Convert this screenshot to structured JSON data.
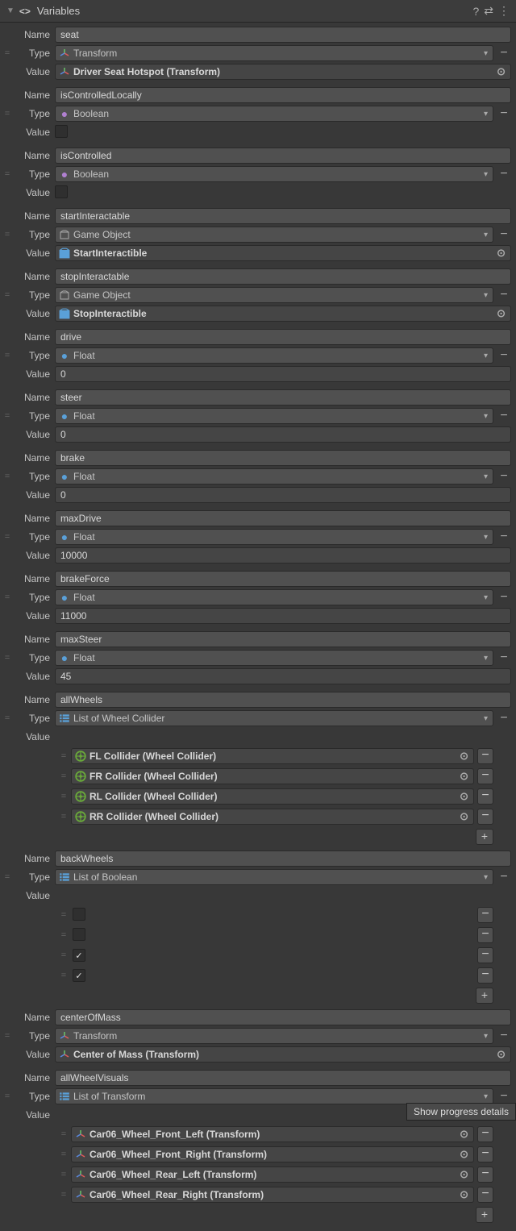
{
  "header": {
    "title": "Variables"
  },
  "labels": {
    "name": "Name",
    "type": "Type",
    "value": "Value"
  },
  "vars": [
    {
      "name": "seat",
      "type": "Transform",
      "typeIcon": "transform",
      "value": "Driver Seat Hotspot (Transform)",
      "valueKind": "obj"
    },
    {
      "name": "isControlledLocally",
      "type": "Boolean",
      "typeIcon": "bool",
      "valueKind": "checkbox",
      "checked": false
    },
    {
      "name": "isControlled",
      "type": "Boolean",
      "typeIcon": "bool",
      "valueKind": "checkbox",
      "checked": false
    },
    {
      "name": "startInteractable",
      "type": "Game Object",
      "typeIcon": "go",
      "value": "StartInteractible",
      "valueKind": "obj-prefab"
    },
    {
      "name": "stopInteractable",
      "type": "Game Object",
      "typeIcon": "go",
      "value": "StopInteractible",
      "valueKind": "obj-prefab"
    },
    {
      "name": "drive",
      "type": "Float",
      "typeIcon": "float",
      "value": "0",
      "valueKind": "text"
    },
    {
      "name": "steer",
      "type": "Float",
      "typeIcon": "float",
      "value": "0",
      "valueKind": "text"
    },
    {
      "name": "brake",
      "type": "Float",
      "typeIcon": "float",
      "value": "0",
      "valueKind": "text"
    },
    {
      "name": "maxDrive",
      "type": "Float",
      "typeIcon": "float",
      "value": "10000",
      "valueKind": "text"
    },
    {
      "name": "brakeForce",
      "type": "Float",
      "typeIcon": "float",
      "value": "11000",
      "valueKind": "text"
    },
    {
      "name": "maxSteer",
      "type": "Float",
      "typeIcon": "float",
      "value": "45",
      "valueKind": "text"
    },
    {
      "name": "allWheels",
      "type": "List of Wheel Collider",
      "typeIcon": "list",
      "valueKind": "list-obj",
      "items": [
        "FL Collider (Wheel Collider)",
        "FR Collider (Wheel Collider)",
        "RL Collider (Wheel Collider)",
        "RR Collider (Wheel Collider)"
      ],
      "itemIcon": "wheel"
    },
    {
      "name": "backWheels",
      "type": "List of Boolean",
      "typeIcon": "list",
      "valueKind": "list-bool",
      "boolItems": [
        false,
        false,
        true,
        true
      ]
    },
    {
      "name": "centerOfMass",
      "type": "Transform",
      "typeIcon": "transform",
      "value": "Center of Mass (Transform)",
      "valueKind": "obj"
    },
    {
      "name": "allWheelVisuals",
      "type": "List of Transform",
      "typeIcon": "list",
      "valueKind": "list-obj",
      "items": [
        "Car06_Wheel_Front_Left (Transform)",
        "Car06_Wheel_Front_Right (Transform)",
        "Car06_Wheel_Rear_Left (Transform)",
        "Car06_Wheel_Rear_Right (Transform)"
      ],
      "itemIcon": "transform"
    }
  ],
  "tooltip": "Show progress details"
}
